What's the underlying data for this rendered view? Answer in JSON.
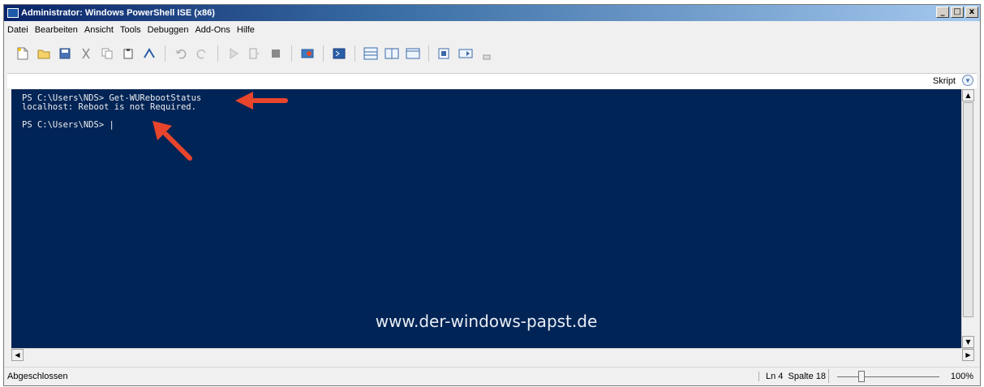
{
  "window": {
    "title": "Administrator: Windows PowerShell ISE (x86)"
  },
  "menu": [
    "Datei",
    "Bearbeiten",
    "Ansicht",
    "Tools",
    "Debuggen",
    "Add-Ons",
    "Hilfe"
  ],
  "script_pane": {
    "label": "Skript"
  },
  "console": {
    "lines": [
      "PS C:\\Users\\NDS> Get-WURebootStatus",
      "localhost: Reboot is not Required.",
      "",
      "PS C:\\Users\\NDS> |"
    ],
    "watermark": "www.der-windows-papst.de",
    "background": "#012456"
  },
  "status": {
    "text": "Abgeschlossen",
    "position": "Ln 4  Spalte 18",
    "zoom": "100%"
  },
  "annotations": {
    "arrow_color": "#e8452c"
  },
  "window_buttons": [
    "_",
    "□",
    "x"
  ]
}
